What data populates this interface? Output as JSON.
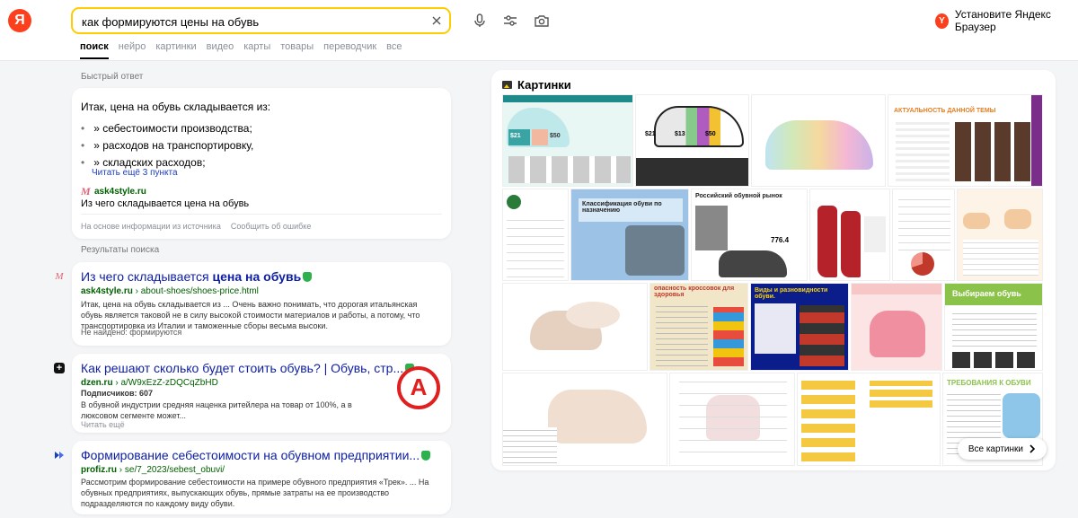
{
  "header": {
    "logo_letter": "Я",
    "search_query": "как формируются цены на обувь",
    "browser_promo_badge": "Y",
    "browser_promo": "Установите Яндекс Браузер",
    "tabs": [
      {
        "label": "поиск",
        "active": true
      },
      {
        "label": "нейро"
      },
      {
        "label": "картинки"
      },
      {
        "label": "видео"
      },
      {
        "label": "карты"
      },
      {
        "label": "товары"
      },
      {
        "label": "переводчик"
      },
      {
        "label": "все"
      }
    ]
  },
  "quick_answer": {
    "section_label": "Быстрый ответ",
    "intro": "Итак, цена на обувь складывается из:",
    "items": [
      "» себестоимости производства;",
      "» расходов на транспортировку,",
      "» складских расходов;"
    ],
    "more": "Читать ещё 3 пункта",
    "source_domain": "ask4style.ru",
    "source_favicon": "M",
    "source_title": "Из чего складывается цена на обувь",
    "footer_info": "На основе информации из источника",
    "footer_report": "Сообщить об ошибке"
  },
  "results_label": "Результаты поиска",
  "results": [
    {
      "favicon": "M",
      "title_a": "Из чего складывается ",
      "title_b": "цена на обувь",
      "domain": "ask4style.ru",
      "path": " › about-shoes/shoes-price.html",
      "snippet": "Итак, цена на обувь складывается из ... Очень важно понимать, что дорогая итальянская обувь является таковой не в силу высокой стоимости материалов и работы, а потому, что транспортировка из Италии и таможенные сборы весьма высоки.",
      "foot": "Не найдено: формируются"
    },
    {
      "favicon": "+",
      "title": "Как решают сколько будет стоить обувь? | Обувь, стр...",
      "domain": "dzen.ru",
      "path": " › a/W9xEzZ-zDQCqZbHD",
      "subscribers": "Подписчиков: 607",
      "snippet": "В обувной индустрии средняя наценка ритейлера на товар от 100%, а в люксовом сегменте может...",
      "foot": "Читать ещё"
    },
    {
      "favicon": "",
      "title": "Формирование себестоимости на обувном предприятии...",
      "domain": "profiz.ru",
      "path": " › se/7_2023/sebest_obuvi/",
      "snippet": "Рассмотрим формирование себестоимости на примере обувного предприятия «Трек». ... На обувных предприятиях, выпускающих обувь, прямые затраты на ее производство подразделяются по каждому виду обуви."
    }
  ],
  "images": {
    "title": "Картинки",
    "all_button": "Все картинки",
    "thumb_labels": [
      "Классификация обуви по назначению",
      "Российский обувной рынок",
      "776.4",
      "АКТУАЛЬНОСТЬ ДАННОЙ ТЕМЫ",
      "$21",
      "$13",
      "$50",
      "Виды и разновидности обуви.",
      "Выбираем обувь",
      "ТРЕБОВАНИЯ К ОБУВИ",
      "опасность кроссовок для здоровья"
    ]
  }
}
